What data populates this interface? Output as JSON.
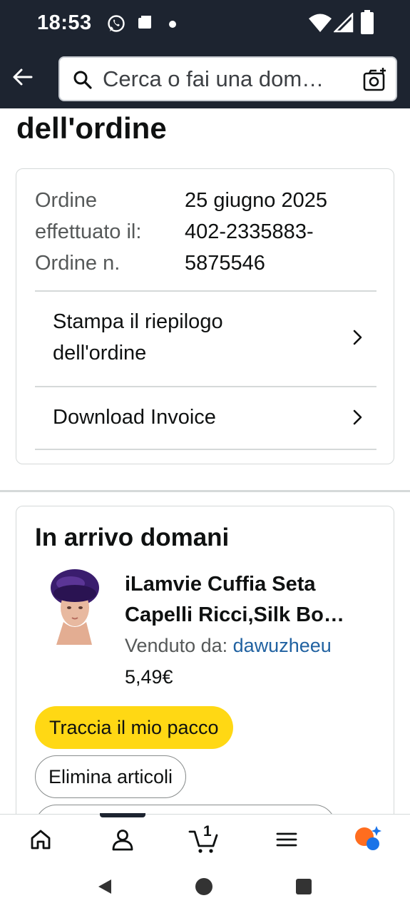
{
  "status_bar": {
    "time": "18:53"
  },
  "search": {
    "placeholder": "Cerca o fai una dom…"
  },
  "page": {
    "title": "dell'ordine"
  },
  "order": {
    "date_label": "Ordine",
    "date_label_2": "effettuato il:",
    "date_value": "25 giugno 2025",
    "number_label": "Ordine n.",
    "number_value_1": "402-2335883-",
    "number_value_2": "5875546",
    "print_line1": "Stampa il riepilogo",
    "print_line2": "dell'ordine",
    "invoice": "Download Invoice"
  },
  "delivery": {
    "title": "In arrivo domani",
    "product_line1": "iLamvie Cuffia Seta",
    "product_line2": "Capelli Ricci,Silk Bo…",
    "sold_by_label": "Venduto da:",
    "seller": "dawuzheeu",
    "price": "5,49€",
    "track_button": "Traccia il mio pacco",
    "delete_button": "Elimina articoli"
  },
  "bottom_nav": {
    "cart_count": "1"
  },
  "colors": {
    "header_bg": "#1d2430",
    "accent_yellow": "#ffd814",
    "link_blue": "#2162a1",
    "rufus_orange": "#ff6d1f",
    "rufus_blue": "#1a73e8"
  },
  "icons": [
    "back-arrow-icon",
    "search-icon",
    "camera-icon",
    "chevron-right-icon",
    "home-icon",
    "account-icon",
    "cart-icon",
    "menu-icon",
    "rufus-icon"
  ]
}
